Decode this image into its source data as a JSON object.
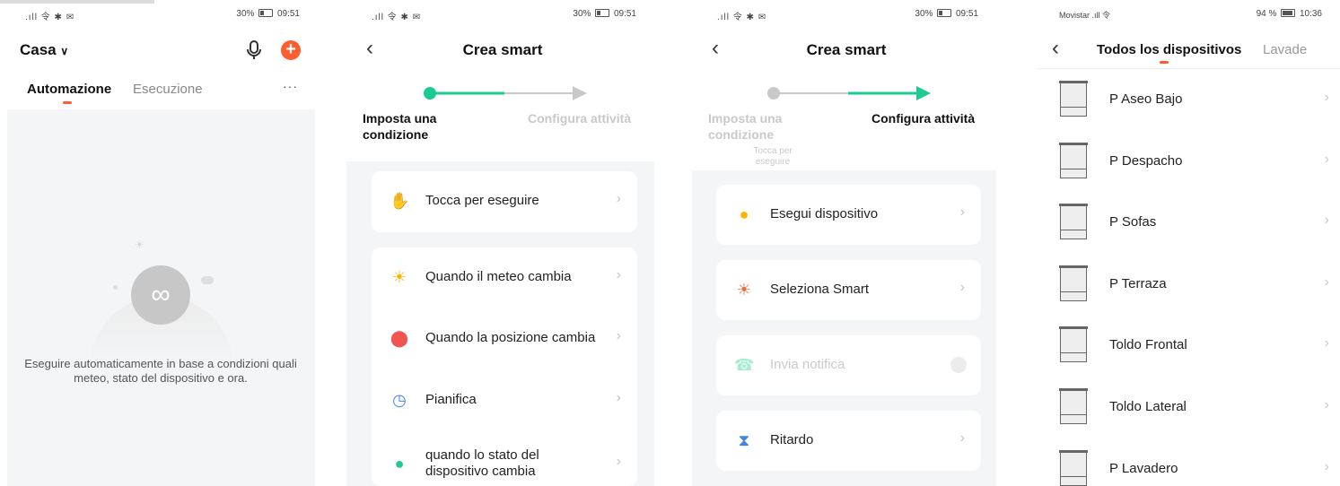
{
  "screen1": {
    "status_left": ".ıll 令 ✱ ✉",
    "status_right_pct": "30%",
    "status_time": "09:51",
    "home_label": "Casa",
    "tabs": [
      "Automazione",
      "Esecuzione"
    ],
    "more": "···",
    "empty_text": "Eseguire automaticamente in base a condizioni quali meteo, stato del dispositivo e ora."
  },
  "screen2": {
    "status_left": ".ıll 令 ✱ ✉",
    "status_right_pct": "30%",
    "status_time": "09:51",
    "title": "Crea smart",
    "step1": "Imposta una condizione",
    "step2": "Configura attività",
    "tap_item": "Tocca per eseguire",
    "items": [
      "Quando il meteo cambia",
      "Quando la posizione cambia",
      "Pianifica",
      "quando lo stato del dispositivo cambia"
    ]
  },
  "screen3": {
    "status_left": ".ıll 令 ✱ ✉",
    "status_right_pct": "30%",
    "status_time": "09:51",
    "title": "Crea smart",
    "step1": "Imposta una condizione",
    "step1_sub": "Tocca per eseguire",
    "step2": "Configura attività",
    "items": [
      "Esegui dispositivo",
      "Seleziona Smart",
      "Invia notifica",
      "Ritardo"
    ]
  },
  "screen4": {
    "status_left": "Movistar .ıll 令",
    "status_right": "94 %",
    "status_time": "10:36",
    "tab_active": "Todos los dispositivos",
    "tab_next": "Lavade",
    "devices": [
      "P Aseo Bajo",
      "P Despacho",
      "P Sofas",
      "P Terraza",
      "Toldo Frontal",
      "Toldo Lateral",
      "P Lavadero"
    ]
  },
  "colors": {
    "accent": "#ff5d2e",
    "green": "#1ccb8e",
    "grey_text": "#c9c9c9"
  }
}
